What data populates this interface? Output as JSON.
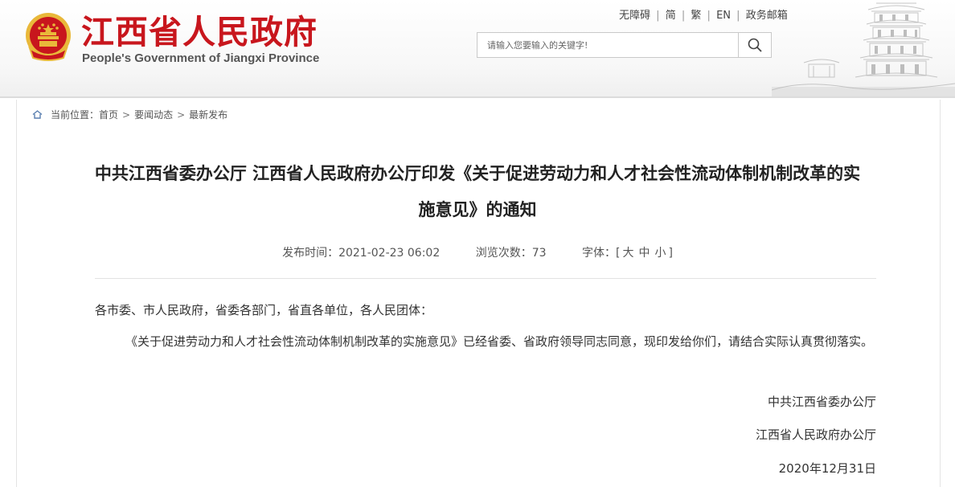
{
  "header": {
    "title_cn": "江西省人民政府",
    "title_en": "People's Government of Jiangxi Province",
    "top_links": [
      "无障碍",
      "简",
      "繁",
      "EN",
      "政务邮箱"
    ],
    "search_placeholder": "请输入您要输入的关键字!"
  },
  "breadcrumb": {
    "label": "当前位置：",
    "items": [
      "首页",
      "要闻动态",
      "最新发布"
    ]
  },
  "article": {
    "title": "中共江西省委办公厅 江西省人民政府办公厅印发《关于促进劳动力和人才社会性流动体制机制改革的实施意见》的通知",
    "meta": {
      "publish_label": "发布时间：",
      "publish_time": "2021-02-23 06:02",
      "views_label": "浏览次数：",
      "views": "73",
      "font_label": "字体：",
      "font_open": "[",
      "font_sizes": [
        "大",
        "中",
        "小"
      ],
      "font_close": "]"
    },
    "salutation": "各市委、市人民政府，省委各部门，省直各单位，各人民团体：",
    "body": "《关于促进劳动力和人才社会性流动体制机制改革的实施意见》已经省委、省政府领导同志同意，现印发给你们，请结合实际认真贯彻落实。",
    "signers": [
      "中共江西省委办公厅",
      "江西省人民政府办公厅"
    ],
    "date": "2020年12月31日"
  },
  "colors": {
    "brand_red": "#c8161d",
    "emblem_gold": "#e9b83a"
  },
  "icons": [
    "national-emblem-icon",
    "search-icon",
    "home-icon",
    "pagoda-illustration"
  ]
}
